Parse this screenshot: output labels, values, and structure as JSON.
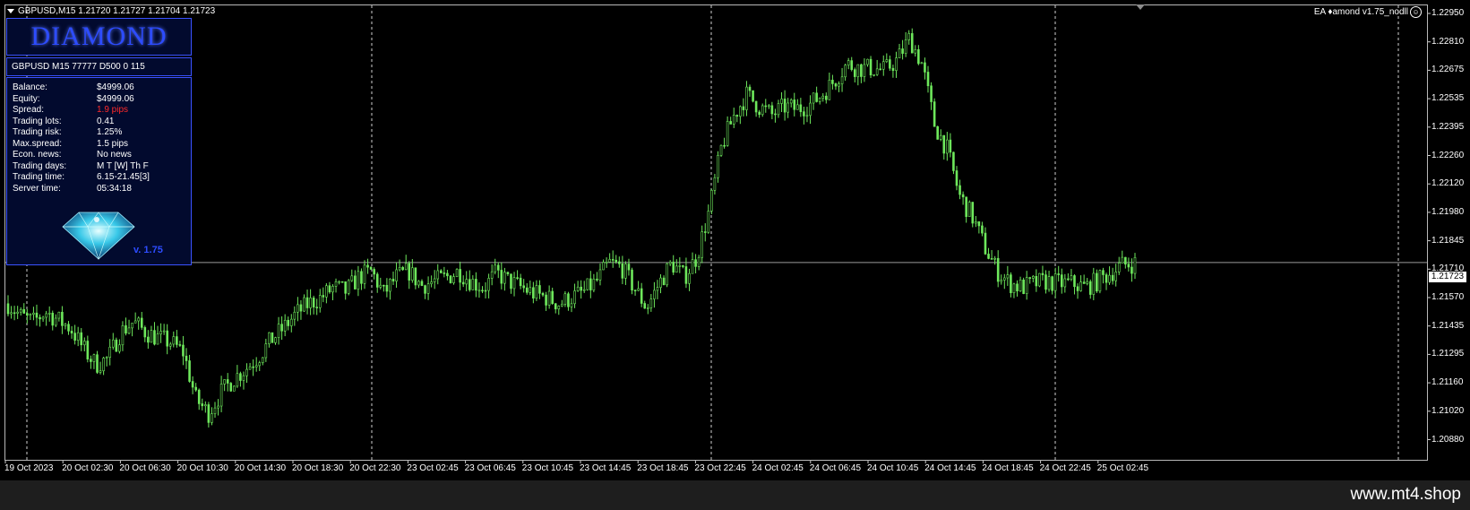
{
  "chart": {
    "title": "GBPUSD,M15  1.21720 1.21727 1.21704 1.21723",
    "ea_label": "EA ♦amond v1.75_nodll",
    "current_price": "1.21723",
    "watermark": "www.mt4.shop",
    "colors": {
      "background": "#000000",
      "candle": "#6ee85c",
      "grid": "#b8b8b8",
      "panel_border": "#3a52ff",
      "spread": "#ff2a2a"
    }
  },
  "chart_data": {
    "type": "candlestick",
    "symbol": "GBPUSD",
    "timeframe": "M15",
    "ylim": [
      1.208,
      1.23
    ],
    "price_ticks": [
      "1.22950",
      "1.22810",
      "1.22675",
      "1.22535",
      "1.22395",
      "1.22260",
      "1.22120",
      "1.21980",
      "1.21845",
      "1.21710",
      "1.21570",
      "1.21435",
      "1.21295",
      "1.21160",
      "1.21020",
      "1.20880"
    ],
    "time_ticks": [
      "19 Oct 2023",
      "20 Oct 02:30",
      "20 Oct 06:30",
      "20 Oct 10:30",
      "20 Oct 14:30",
      "20 Oct 18:30",
      "20 Oct 22:30",
      "23 Oct 02:45",
      "23 Oct 06:45",
      "23 Oct 10:45",
      "23 Oct 14:45",
      "23 Oct 18:45",
      "23 Oct 22:45",
      "24 Oct 02:45",
      "24 Oct 06:45",
      "24 Oct 10:45",
      "24 Oct 14:45",
      "24 Oct 18:45",
      "24 Oct 22:45",
      "25 Oct 02:45"
    ],
    "close_path": [
      1.2152,
      1.2146,
      1.2143,
      1.2148,
      1.2144,
      1.214,
      1.213,
      1.2122,
      1.2125,
      1.2138,
      1.2143,
      1.2138,
      1.2135,
      1.2133,
      1.2128,
      1.2105,
      1.2098,
      1.2108,
      1.2115,
      1.212,
      1.2126,
      1.2134,
      1.214,
      1.2147,
      1.2152,
      1.2155,
      1.216,
      1.2158,
      1.2165,
      1.2168,
      1.2157,
      1.2165,
      1.2168,
      1.2161,
      1.2163,
      1.2165,
      1.2168,
      1.2163,
      1.216,
      1.2167,
      1.2163,
      1.216,
      1.2157,
      1.2155,
      1.2152,
      1.2155,
      1.2158,
      1.2163,
      1.2172,
      1.217,
      1.216,
      1.215,
      1.2162,
      1.2172,
      1.2165,
      1.2175,
      1.2198,
      1.223,
      1.2245,
      1.2255,
      1.2249,
      1.2245,
      1.2249,
      1.2248,
      1.225,
      1.2255,
      1.2262,
      1.227,
      1.2268,
      1.2268,
      1.2267,
      1.2272,
      1.2283,
      1.227,
      1.224,
      1.2228,
      1.2205,
      1.2195,
      1.218,
      1.2168,
      1.2162,
      1.216,
      1.2162,
      1.2163,
      1.2162,
      1.2162,
      1.216,
      1.2163,
      1.2167,
      1.2171,
      1.2172
    ]
  },
  "panel": {
    "logo_text": "DIAMOND",
    "symbol_line": "GBPUSD M15 77777  D500 0 115",
    "rows": [
      {
        "label": "Balance:",
        "value": "$4999.06"
      },
      {
        "label": "Equity:",
        "value": "$4999.06"
      },
      {
        "label": "Spread:",
        "value": "1.9 pips"
      },
      {
        "label": "Trading lots:",
        "value": "0.41"
      },
      {
        "label": "Trading risk:",
        "value": "1.25%"
      },
      {
        "label": "Max.spread:",
        "value": "1.5 pips"
      },
      {
        "label": "Econ. news:",
        "value": "No news"
      },
      {
        "label": "Trading days:",
        "value": "M T [W] Th F"
      },
      {
        "label": "Trading time:",
        "value": "6.15-21.45[3]"
      },
      {
        "label": "Server time:",
        "value": "05:34:18"
      }
    ],
    "version": "v. 1.75",
    "diamond_icon": "diamond-icon"
  }
}
